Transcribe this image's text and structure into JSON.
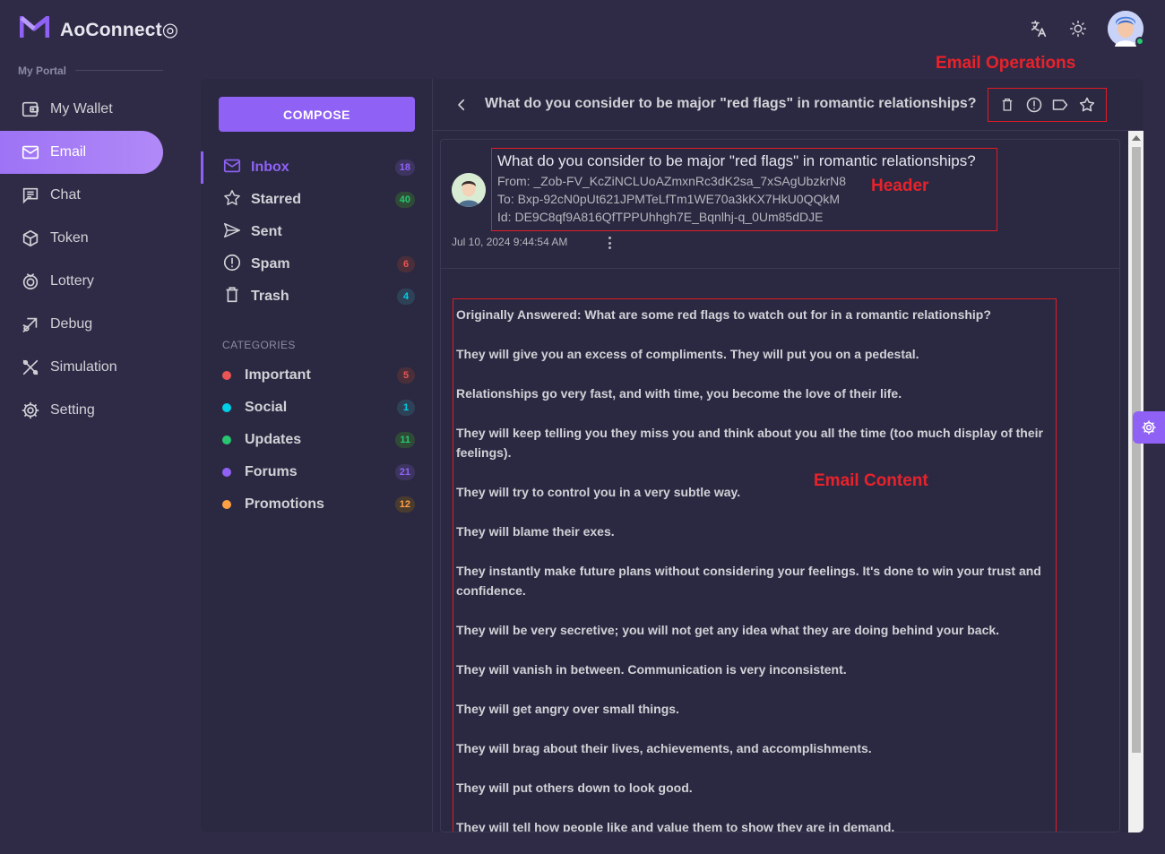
{
  "app": {
    "name": "AoConnect"
  },
  "sidebar": {
    "section_title": "My Portal",
    "items": [
      {
        "label": "My Wallet",
        "icon": "wallet-icon"
      },
      {
        "label": "Email",
        "icon": "mail-icon",
        "active": true
      },
      {
        "label": "Chat",
        "icon": "chat-icon"
      },
      {
        "label": "Token",
        "icon": "token-icon"
      },
      {
        "label": "Lottery",
        "icon": "lottery-icon"
      },
      {
        "label": "Debug",
        "icon": "bug-icon"
      },
      {
        "label": "Simulation",
        "icon": "tools-icon"
      },
      {
        "label": "Setting",
        "icon": "gear-icon"
      }
    ]
  },
  "email": {
    "compose_label": "COMPOSE",
    "folders": [
      {
        "label": "Inbox",
        "count": "18",
        "icon": "mail-icon",
        "active": true,
        "badge_bg": "#3d3560",
        "badge_fg": "#8f62f5"
      },
      {
        "label": "Starred",
        "count": "40",
        "icon": "star-icon",
        "badge_bg": "#2f4a37",
        "badge_fg": "#28c76f"
      },
      {
        "label": "Sent",
        "icon": "send-icon"
      },
      {
        "label": "Spam",
        "count": "6",
        "icon": "alert-circle-icon",
        "badge_bg": "#4a2f3a",
        "badge_fg": "#ea5455"
      },
      {
        "label": "Trash",
        "count": "4",
        "icon": "trash-icon",
        "badge_bg": "#2e4257",
        "badge_fg": "#00cfe8"
      }
    ],
    "categories_title": "CATEGORIES",
    "categories": [
      {
        "label": "Important",
        "count": "5",
        "color": "#ea5455",
        "badge_bg": "#4a2f3a"
      },
      {
        "label": "Social",
        "count": "1",
        "color": "#00cfe8",
        "badge_bg": "#2e4257"
      },
      {
        "label": "Updates",
        "count": "11",
        "color": "#28c76f",
        "badge_bg": "#2f4a37"
      },
      {
        "label": "Forums",
        "count": "21",
        "color": "#8f62f5",
        "badge_bg": "#3d3560"
      },
      {
        "label": "Promotions",
        "count": "12",
        "color": "#ff9f43",
        "badge_bg": "#4a3b2f"
      }
    ]
  },
  "mail": {
    "subject": "What do you consider to be major \"red flags\" in romantic relationships?",
    "from": "From: _Zob-FV_KcZiNCLUoAZmxnRc3dK2sa_7xSAgUbzkrN8",
    "to": "To: Bxp-92cN0pUt621JPMTeLfTm1WE70a3kKX7HkU0QQkM",
    "id": "Id: DE9C8qf9A816QfTPPUhhgh7E_Bqnlhj-q_0Um85dDJE",
    "date": "Jul 10, 2024 9:44:54 AM",
    "paragraphs": [
      "Originally Answered: What are some red flags to watch out for in a romantic relationship?",
      "They will give you an excess of compliments. They will put you on a pedestal.",
      "Relationships go very fast, and with time, you become the love of their life.",
      "They will keep telling you they miss you and think about you all the time (too much display of their feelings).",
      "They will try to control you in a very subtle way.",
      "They will blame their exes.",
      "They instantly make future plans without considering your feelings. It's done to win your trust and confidence.",
      "They will be very secretive; you will not get any idea what they are doing behind your back.",
      "They will vanish in between. Communication is very inconsistent.",
      "They will get angry over small things.",
      "They will brag about their lives, achievements, and accomplishments.",
      "They will put others down to look good.",
      "They will tell how people like and value them to show they are in demand."
    ]
  },
  "annotations": {
    "operations": "Email Operations",
    "header": "Header",
    "content": "Email Content"
  },
  "colors": {
    "accent": "#8f62f5",
    "annotation": "#e8222a"
  }
}
